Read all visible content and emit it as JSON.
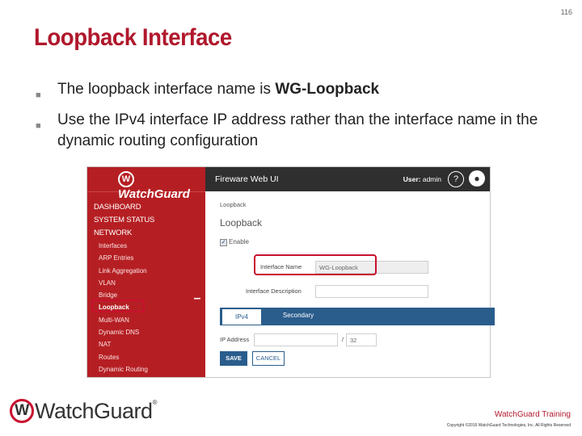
{
  "slide": {
    "number": "116",
    "title": "Loopback Interface",
    "bullets": [
      {
        "text": "The loopback interface name is ",
        "bold": "WG-Loopback"
      },
      {
        "text": "Use the IPv4 interface IP address rather than the interface name in the dynamic routing configuration",
        "bold": ""
      }
    ],
    "footer": {
      "logo_text": "WatchGuard",
      "right_text": "WatchGuard Training",
      "copyright": "Copyright ©2016 WatchGuard Technologies, Inc. All Rights Reserved"
    }
  },
  "ui": {
    "header": {
      "app_name": "Fireware Web UI",
      "user_label": "User:",
      "user_name": "admin",
      "help": "?"
    },
    "logo": "WatchGuard",
    "nav": {
      "dashboard": "DASHBOARD",
      "system_status": "SYSTEM STATUS",
      "network": "NETWORK",
      "items": [
        "Interfaces",
        "ARP Entries",
        "Link Aggregation",
        "VLAN",
        "Bridge",
        "Loopback",
        "Multi-WAN",
        "Dynamic DNS",
        "NAT",
        "Routes",
        "Dynamic Routing"
      ],
      "active": "Loopback"
    },
    "breadcrumb": "Loopback",
    "page_title": "Loopback",
    "enable_label": "Enable",
    "enable_checked": true,
    "interface_name_label": "Interface Name",
    "interface_name_value": "WG-Loopback",
    "interface_description_label": "Interface Description",
    "interface_description_value": "",
    "tabs": [
      "IPv4",
      "Secondary"
    ],
    "active_tab": "IPv4",
    "ip_address_label": "IP Address",
    "ip_address_value": "",
    "prefix_separator": "/",
    "prefix_value": "32",
    "save_label": "SAVE",
    "cancel_label": "CANCEL"
  },
  "colors": {
    "brand_red": "#b0182c",
    "nav_red": "#b51f23",
    "header_dark": "#2f2f2f",
    "accent_blue": "#2a5d8c"
  }
}
